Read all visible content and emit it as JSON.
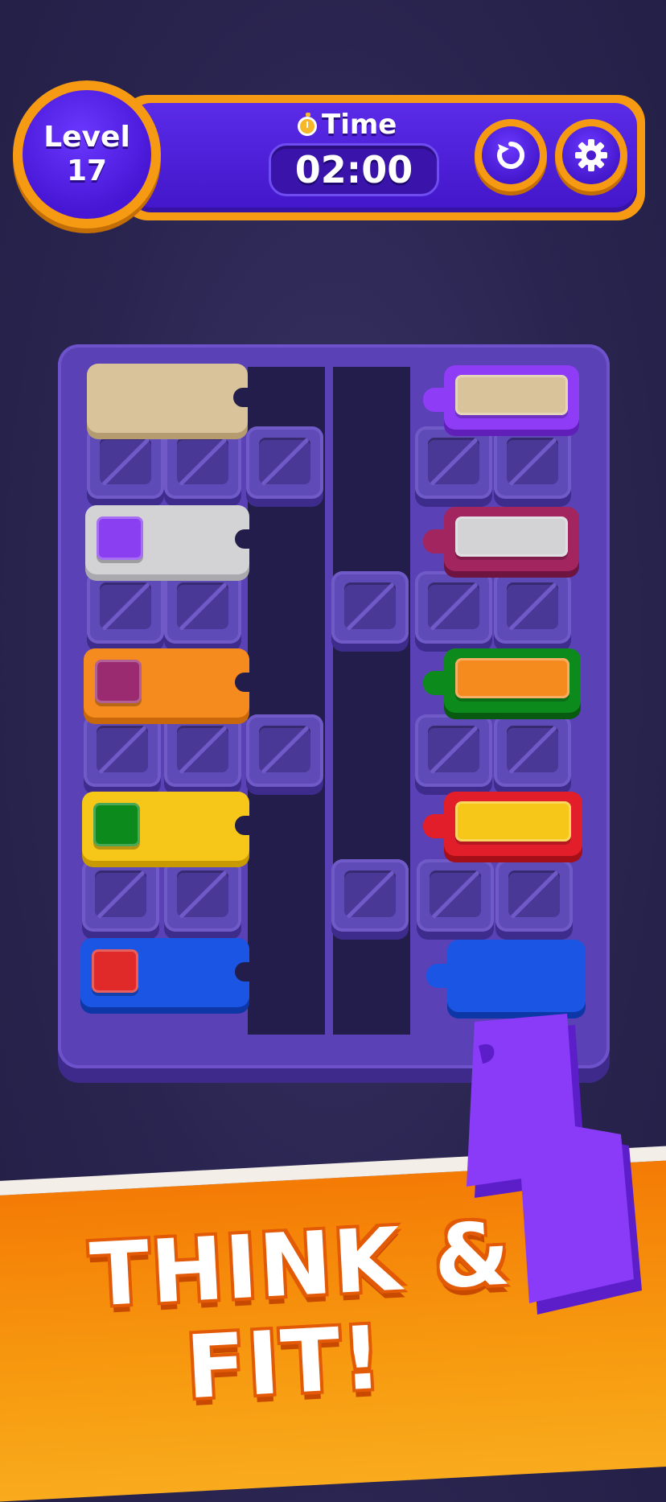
{
  "hud": {
    "level_label": "Level",
    "level_number": "17",
    "time_label": "Time",
    "time_value": "02:00",
    "restart_icon": "restart-icon",
    "settings_icon": "gear-icon"
  },
  "board": {
    "left_blocks": [
      {
        "color": "#d9c39a",
        "gem": null
      },
      {
        "color": "#d3d3d6",
        "gem": "#8a3ff0"
      },
      {
        "color": "#f58b1f",
        "gem": "#9a2b71"
      },
      {
        "color": "#f6c619",
        "gem": "#0d8a1c"
      },
      {
        "color": "#1a55e3",
        "gem": "#e02a2a"
      }
    ],
    "right_blocks": [
      {
        "frame": "#8e3cf5",
        "inner": "#d9c39a"
      },
      {
        "frame": "#a2255f",
        "inner": "#d3d3d6"
      },
      {
        "frame": "#0d8a1c",
        "inner": "#f58b1f"
      },
      {
        "frame": "#e21e2a",
        "inner": "#f6c619"
      },
      {
        "frame": "#1a55e3",
        "inner": "#1a55e3"
      }
    ]
  },
  "footer": {
    "line1": "THINK &",
    "line2": "FIT!"
  }
}
